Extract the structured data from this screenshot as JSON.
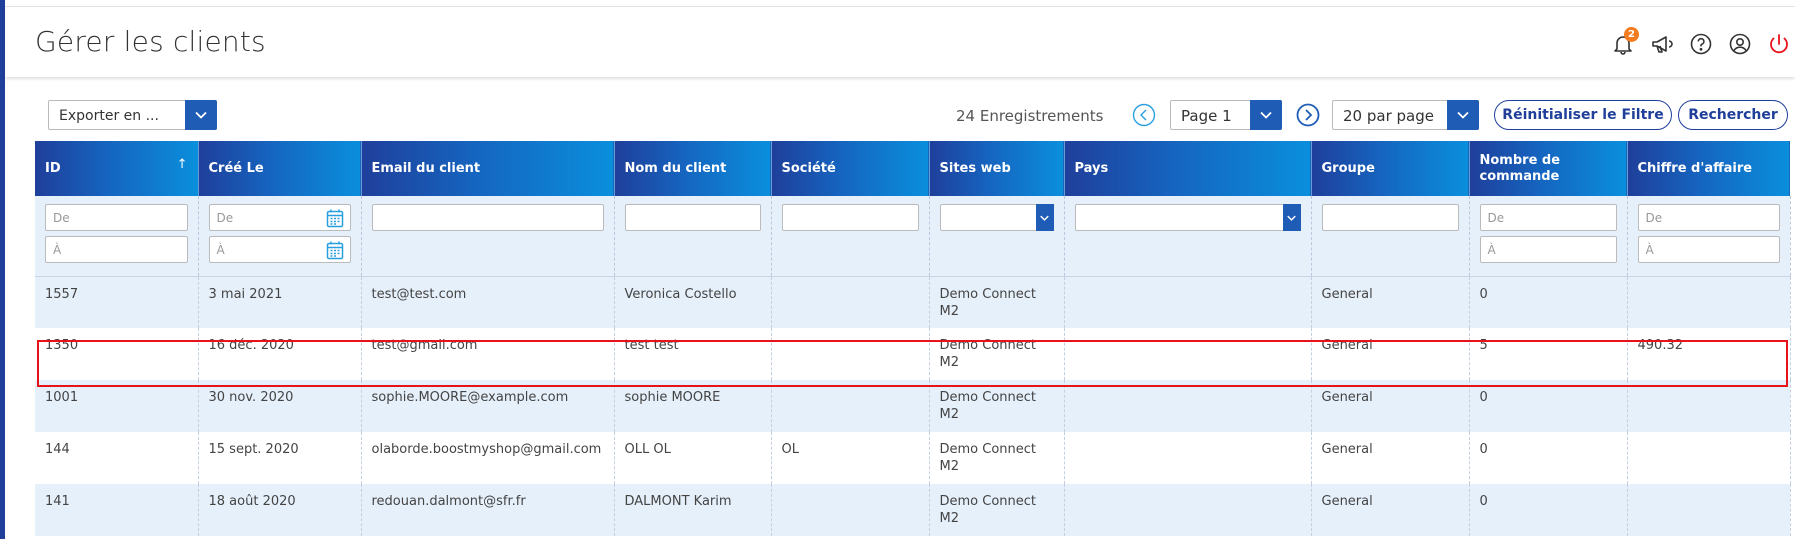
{
  "header": {
    "title": "Gérer les clients",
    "notification_count": "2",
    "icons": [
      "bell-icon",
      "megaphone-icon",
      "help-icon",
      "user-icon",
      "power-icon"
    ],
    "colors": {
      "accent": "#1f3f9b",
      "badge": "#f47c20",
      "power": "#e8121b"
    }
  },
  "toolbar": {
    "export_label": "Exporter en ...",
    "records": "24 Enregistrements",
    "page_label": "Page 1",
    "per_page_label": "20 par page",
    "reset_label": "Réinitialiser le Filtre",
    "search_label": "Rechercher"
  },
  "table": {
    "columns": [
      "ID",
      "Créé Le",
      "Email du client",
      "Nom du client",
      "Société",
      "Sites web",
      "Pays",
      "Groupe",
      "Nombre de commande",
      "Chiffre d'affaire"
    ],
    "sort_indicator": "↑",
    "filters": {
      "from_placeholder": "De",
      "to_placeholder": "À"
    },
    "rows": [
      {
        "id": "1557",
        "created": "3 mai 2021",
        "email": "test@test.com",
        "name": "Veronica Costello",
        "company": "",
        "website": "Demo Connect M2",
        "country": "",
        "group": "General",
        "orders": "0",
        "revenue": ""
      },
      {
        "id": "1350",
        "created": "16 déc. 2020",
        "email": "test@gmail.com",
        "name": "test test",
        "company": "",
        "website": "Demo Connect M2",
        "country": "",
        "group": "General",
        "orders": "5",
        "revenue": "490.32"
      },
      {
        "id": "1001",
        "created": "30 nov. 2020",
        "email": "sophie.MOORE@example.com",
        "name": "sophie MOORE",
        "company": "",
        "website": "Demo Connect M2",
        "country": "",
        "group": "General",
        "orders": "0",
        "revenue": ""
      },
      {
        "id": "144",
        "created": "15 sept. 2020",
        "email": "olaborde.boostmyshop@gmail.com",
        "name": "OLL OL",
        "company": "OL",
        "website": "Demo Connect M2",
        "country": "",
        "group": "General",
        "orders": "0",
        "revenue": ""
      },
      {
        "id": "141",
        "created": "18 août 2020",
        "email": "redouan.dalmont@sfr.fr",
        "name": "DALMONT Karim",
        "company": "",
        "website": "Demo Connect M2",
        "country": "",
        "group": "General",
        "orders": "0",
        "revenue": ""
      }
    ]
  }
}
